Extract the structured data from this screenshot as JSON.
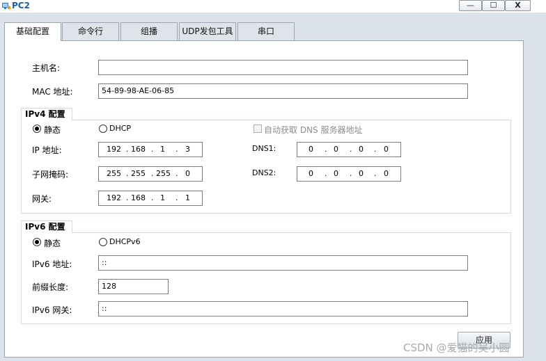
{
  "window": {
    "title": "PC2",
    "minimize": "—",
    "maximize": "☐",
    "close": "X"
  },
  "tabs": [
    "基础配置",
    "命令行",
    "组播",
    "UDP发包工具",
    "串口"
  ],
  "basic": {
    "hostname_label": "主机名:",
    "hostname_value": "",
    "mac_label": "MAC 地址:",
    "mac_value": "54-89-98-AE-06-85"
  },
  "ipv4": {
    "title": "IPv4 配置",
    "static_label": "静态",
    "dhcp_label": "DHCP",
    "auto_dns_label": "自动获取 DNS 服务器地址",
    "ip_label": "IP 地址:",
    "ip": [
      "192",
      "168",
      "1",
      "3"
    ],
    "mask_label": "子网掩码:",
    "mask": [
      "255",
      "255",
      "255",
      "0"
    ],
    "gateway_label": "网关:",
    "gateway": [
      "192",
      "168",
      "1",
      "1"
    ],
    "dns1_label": "DNS1:",
    "dns1": [
      "0",
      "0",
      "0",
      "0"
    ],
    "dns2_label": "DNS2:",
    "dns2": [
      "0",
      "0",
      "0",
      "0"
    ]
  },
  "ipv6": {
    "title": "IPv6 配置",
    "static_label": "静态",
    "dhcpv6_label": "DHCPv6",
    "ip_label": "IPv6 地址:",
    "ip_value": "::",
    "prefix_label": "前缀长度:",
    "prefix_value": "128",
    "gateway_label": "IPv6 网关:",
    "gateway_value": "::"
  },
  "apply_label": "应用",
  "watermark": "CSDN @爱猫的吴小圆"
}
